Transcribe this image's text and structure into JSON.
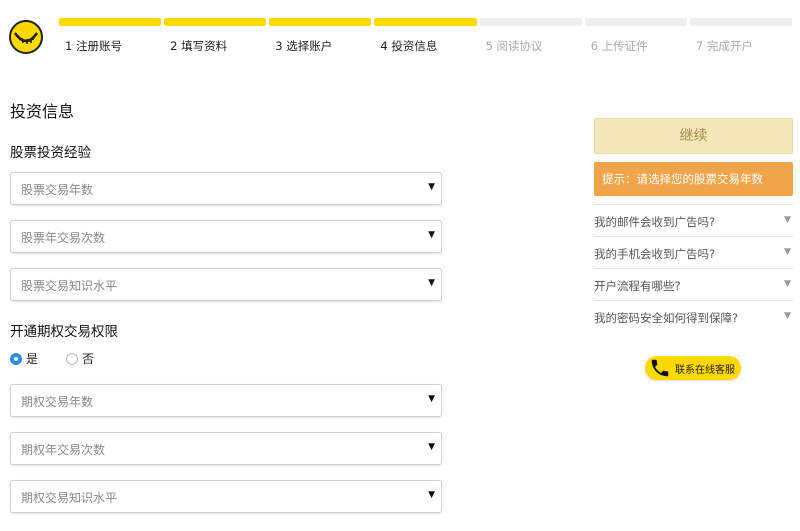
{
  "steps": [
    {
      "label": "1 注册账号",
      "done": true
    },
    {
      "label": "2 填写资料",
      "done": true
    },
    {
      "label": "3 选择账户",
      "done": true
    },
    {
      "label": "4 投资信息",
      "done": true
    },
    {
      "label": "5 阅读协议",
      "done": false
    },
    {
      "label": "6 上传证件",
      "done": false
    },
    {
      "label": "7 完成开户",
      "done": false
    }
  ],
  "page_title": "投资信息",
  "stock_section": {
    "title": "股票投资经验",
    "selects": [
      "股票交易年数",
      "股票年交易次数",
      "股票交易知识水平"
    ]
  },
  "options_section": {
    "title": "开通期权交易权限",
    "radio_yes": "是",
    "radio_no": "否",
    "selected": "yes",
    "selects": [
      "期权交易年数",
      "期权年交易次数",
      "期权交易知识水平"
    ]
  },
  "sidebar": {
    "continue_label": "继续",
    "hint": "提示：请选择您的股票交易年数",
    "faq": [
      "我的邮件会收到广告吗?",
      "我的手机会收到广告吗?",
      "开户流程有哪些?",
      "我的密码安全如何得到保障?"
    ],
    "service_label": "联系在线客服"
  },
  "colors": {
    "accent": "#ffd800",
    "hint_bg": "#f0a44a",
    "continue_bg": "#f4e7b8",
    "radio_checked": "#2d8cf0"
  },
  "icons": {
    "logo": "smile-logo-icon",
    "dropdown": "caret-down-icon",
    "service": "phone-icon"
  }
}
